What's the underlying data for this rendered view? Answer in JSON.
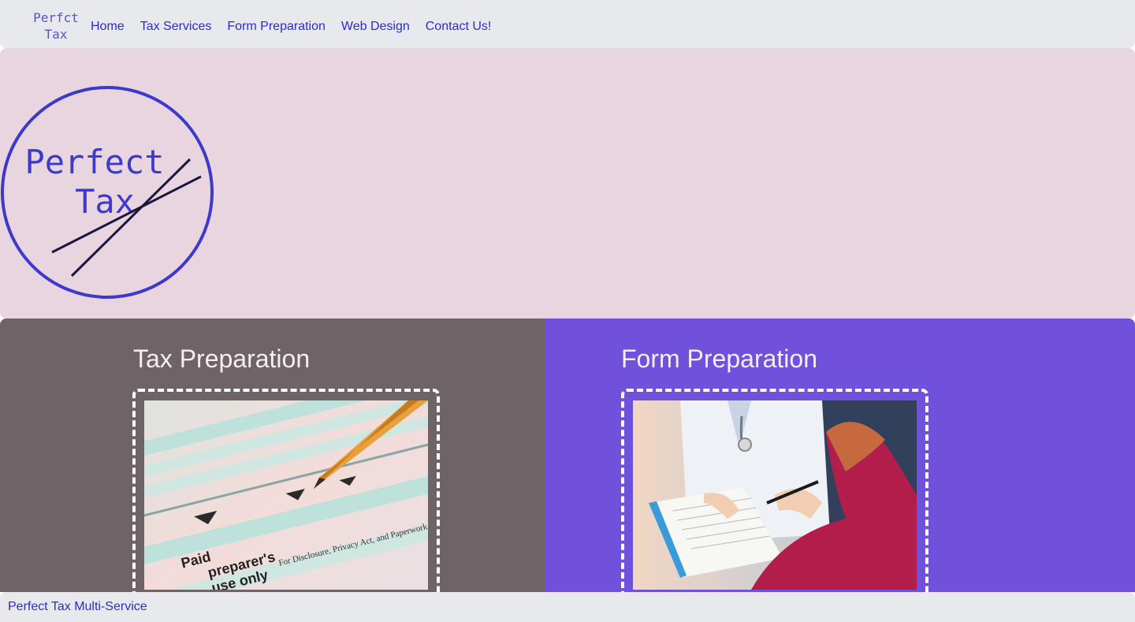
{
  "navbar": {
    "brand_line1": "Perfct",
    "brand_line2": "Tax",
    "links": [
      {
        "label": "Home"
      },
      {
        "label": "Tax Services"
      },
      {
        "label": "Form Preparation"
      },
      {
        "label": "Web Design"
      },
      {
        "label": "Contact Us!"
      }
    ]
  },
  "hero": {
    "logo_line1": "Perfect",
    "logo_line2": "Tax"
  },
  "sections": [
    {
      "title": "Tax Preparation",
      "image_label": "tax-form-pencil-photo",
      "image_text_1": "Paid",
      "image_text_2": "preparer's",
      "image_text_3": "use only",
      "image_text_4": "For Disclosure, Privacy Act, and Paperwork Reduction Act Notice"
    },
    {
      "title": "Form Preparation",
      "image_label": "doctor-clipboard-photo"
    }
  ],
  "footer": {
    "text": "Perfect Tax Multi-Service"
  },
  "colors": {
    "nav_bg": "#e8e9ec",
    "hero_bg": "#e8d5e0",
    "left_panel_bg": "#6e6468",
    "right_panel_bg": "#7051dc",
    "link": "#2b2bd0",
    "logo": "#3d3acb"
  }
}
